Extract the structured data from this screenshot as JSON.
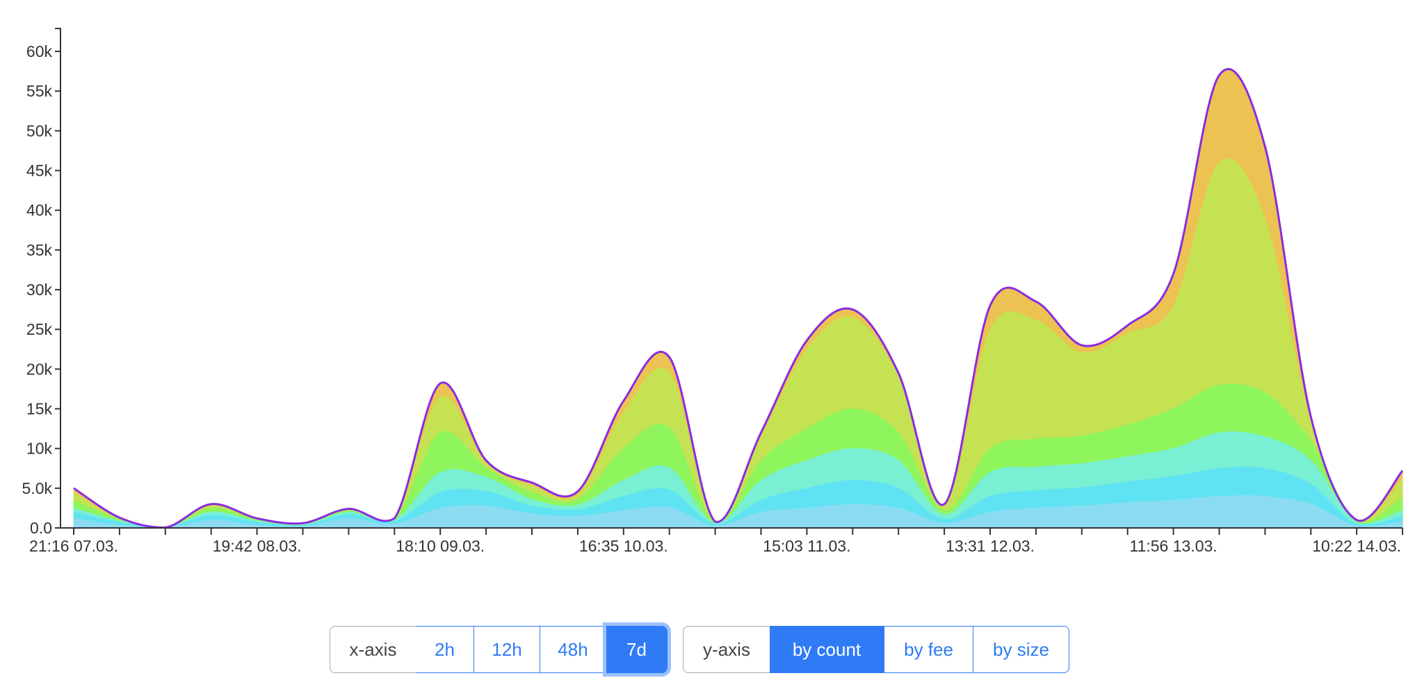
{
  "chart_data": {
    "type": "area",
    "stacked": true,
    "grid": false,
    "legend": "none",
    "ylim": [
      0,
      62900
    ],
    "y_ticks": [
      "0.0",
      "5.0k",
      "10k",
      "15k",
      "20k",
      "25k",
      "30k",
      "35k",
      "40k",
      "45k",
      "50k",
      "55k",
      "60k"
    ],
    "y_tick_values": [
      0,
      5000,
      10000,
      15000,
      20000,
      25000,
      30000,
      35000,
      40000,
      45000,
      50000,
      55000,
      60000
    ],
    "x_tick_labels": [
      "21:16 07.03.",
      "19:42 08.03.",
      "18:10 09.03.",
      "16:35 10.03.",
      "15:03 11.03.",
      "13:31 12.03.",
      "11:56 13.03.",
      "10:22 14.03."
    ],
    "x": [
      "07.03. 21:16",
      "08.03. 02:53",
      "08.03. 08:29",
      "08.03. 14:06",
      "08.03. 19:42",
      "09.03. 01:19",
      "09.03. 06:56",
      "09.03. 12:32",
      "09.03. 18:10",
      "09.03. 23:46",
      "10.03. 05:22",
      "10.03. 10:59",
      "10.03. 16:35",
      "10.03. 22:12",
      "11.03. 03:49",
      "11.03. 09:26",
      "11.03. 15:03",
      "11.03. 20:39",
      "12.03. 02:15",
      "12.03. 07:52",
      "12.03. 13:31",
      "12.03. 19:05",
      "13.03. 00:42",
      "13.03. 06:19",
      "13.03. 11:56",
      "13.03. 17:32",
      "13.03. 23:09",
      "14.03. 04:45",
      "14.03. 10:22",
      "14.03. 15:59"
    ],
    "series": [
      {
        "color": "#8bdcf3",
        "values": [
          1200,
          400,
          50,
          1000,
          400,
          200,
          1200,
          500,
          2500,
          2800,
          1800,
          1500,
          2200,
          2600,
          300,
          2000,
          2500,
          3000,
          2500,
          600,
          2000,
          2500,
          2800,
          3200,
          3500,
          4000,
          4000,
          3000,
          300,
          800
        ]
      },
      {
        "color": "#5fe3f2",
        "values": [
          800,
          300,
          0,
          600,
          300,
          100,
          500,
          300,
          2000,
          1800,
          1000,
          800,
          1800,
          2200,
          200,
          1500,
          2500,
          3000,
          2500,
          500,
          2000,
          2200,
          2300,
          2600,
          3000,
          3500,
          3500,
          2500,
          200,
          600
        ]
      },
      {
        "color": "#79f0d4",
        "values": [
          500,
          200,
          0,
          400,
          200,
          100,
          300,
          200,
          2500,
          1800,
          800,
          600,
          2000,
          2800,
          100,
          2500,
          3500,
          4000,
          3500,
          600,
          3000,
          3000,
          3000,
          3200,
          3500,
          4500,
          4000,
          3000,
          200,
          800
        ]
      },
      {
        "color": "#8ef55c",
        "values": [
          1000,
          200,
          0,
          500,
          200,
          100,
          200,
          100,
          5000,
          1200,
          900,
          700,
          4000,
          5000,
          100,
          2500,
          4000,
          5000,
          3500,
          500,
          3000,
          3500,
          3500,
          4000,
          5000,
          6000,
          5500,
          2500,
          100,
          1600
        ]
      },
      {
        "color": "#c5e252",
        "values": [
          1000,
          100,
          0,
          300,
          100,
          100,
          100,
          100,
          4500,
          600,
          800,
          600,
          4500,
          7000,
          100,
          3000,
          10000,
          11500,
          7000,
          600,
          15000,
          15000,
          10500,
          11500,
          13000,
          28000,
          22000,
          2500,
          100,
          2400
        ]
      },
      {
        "color": "#ecc352",
        "values": [
          500,
          100,
          0,
          200,
          0,
          0,
          100,
          0,
          1700,
          300,
          400,
          400,
          1500,
          1900,
          0,
          500,
          1100,
          1000,
          500,
          200,
          3000,
          2300,
          900,
          1000,
          4000,
          11000,
          9000,
          500,
          100,
          1000
        ]
      }
    ],
    "envelope_color": "#8a2be2"
  },
  "controls": {
    "x_axis": {
      "label": "x-axis",
      "options": [
        "2h",
        "12h",
        "48h",
        "7d"
      ],
      "selected": "7d"
    },
    "y_axis": {
      "label": "y-axis",
      "options": [
        "by count",
        "by fee",
        "by size"
      ],
      "selected": "by count"
    }
  }
}
